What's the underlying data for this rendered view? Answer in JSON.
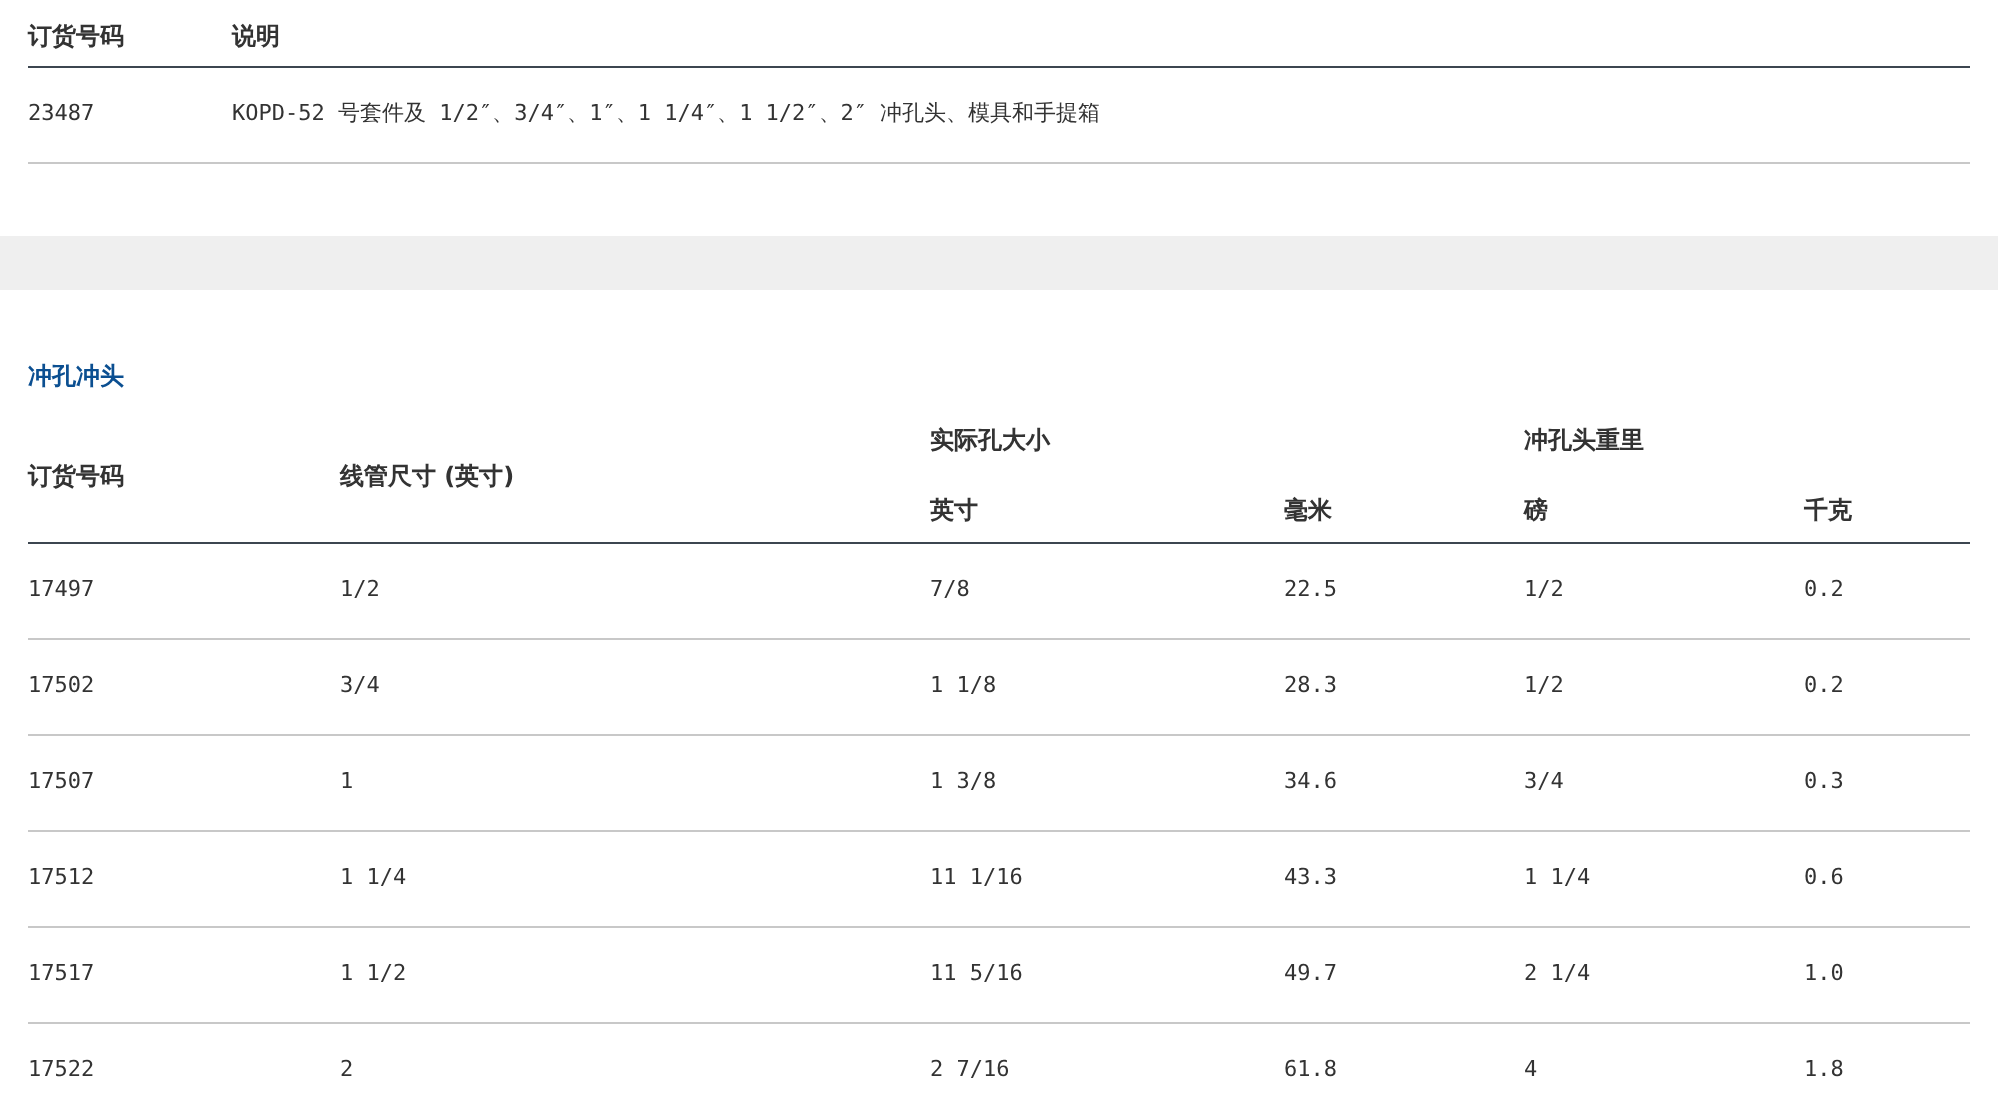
{
  "kit_table": {
    "columns": [
      "订货号码",
      "说明"
    ],
    "rows": [
      {
        "order_no": "23487",
        "description": "KOPD-52 号套件及 1/2″、3/4″、1″、1 1/4″、1 1/2″、2″ 冲孔头、模具和手提箱"
      }
    ]
  },
  "punch_section": {
    "title": "冲孔冲头",
    "columns": {
      "order_no": "订货号码",
      "conduit_size": "线管尺寸 (英寸)",
      "hole_size": "实际孔大小",
      "hole_in": "英寸",
      "hole_mm": "毫米",
      "weight": "冲孔头重里",
      "weight_lb": "磅",
      "weight_kg": "千克"
    },
    "rows": [
      [
        "17497",
        "1/2",
        "7/8",
        "22.5",
        "1/2",
        "0.2"
      ],
      [
        "17502",
        "3/4",
        "1 1/8",
        "28.3",
        "1/2",
        "0.2"
      ],
      [
        "17507",
        "1",
        "1 3/8",
        "34.6",
        "3/4",
        "0.3"
      ],
      [
        "17512",
        "1 1/4",
        "11 1/16",
        "43.3",
        "1 1/4",
        "0.6"
      ],
      [
        "17517",
        "1 1/2",
        "11 5/16",
        "49.7",
        "2 1/4",
        "1.0"
      ],
      [
        "17522",
        "2",
        "2 7/16",
        "61.8",
        "4",
        "1.8"
      ]
    ]
  }
}
